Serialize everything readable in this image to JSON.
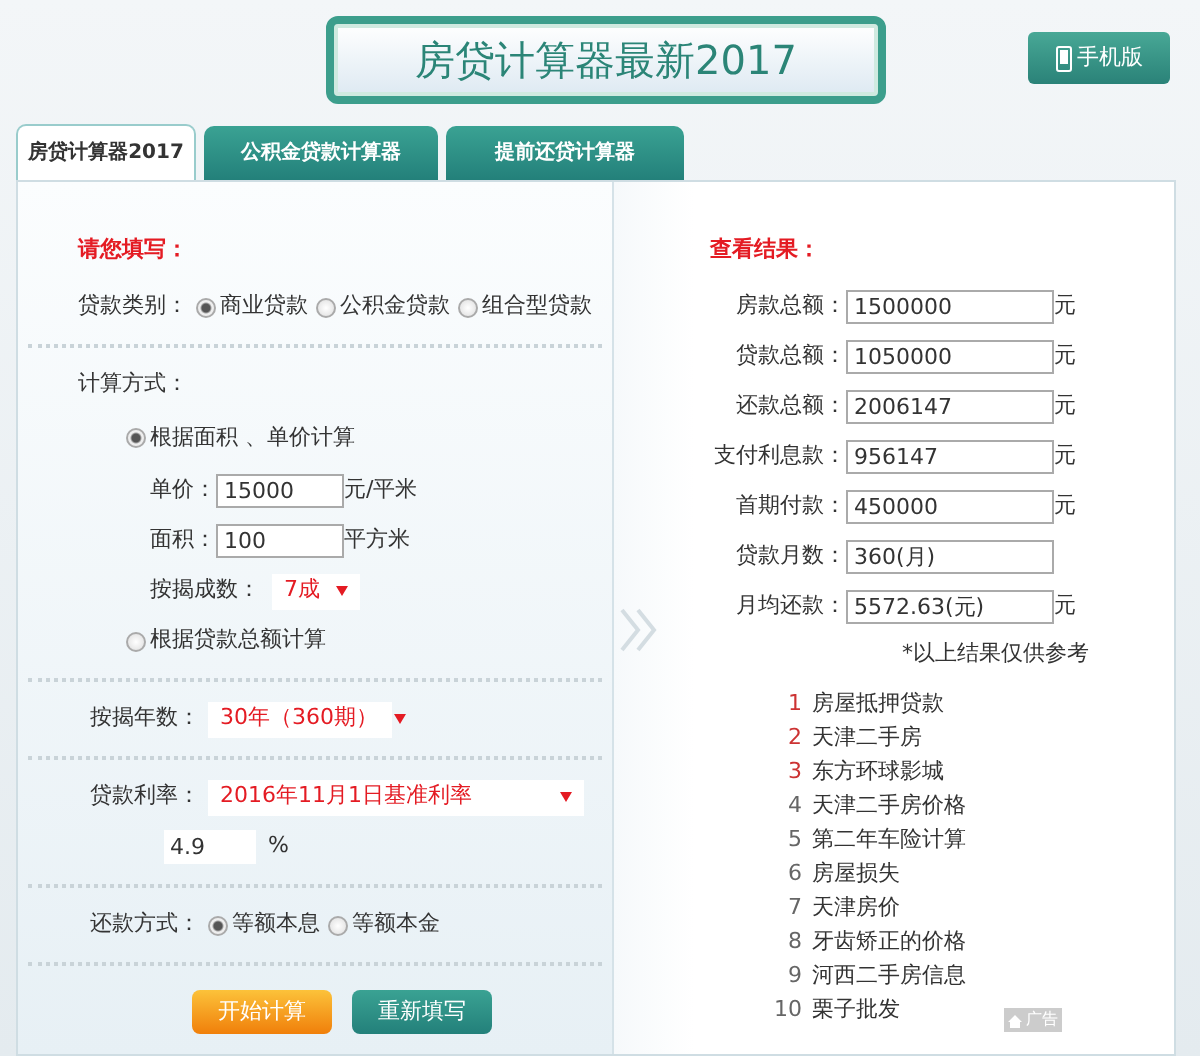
{
  "header": {
    "title": "房贷计算器最新2017",
    "mobile_button": "手机版"
  },
  "tabs": [
    {
      "label": "房贷计算器2017",
      "selected": true
    },
    {
      "label": "公积金贷款计算器",
      "selected": false
    },
    {
      "label": "提前还贷计算器",
      "selected": false
    }
  ],
  "form": {
    "heading": "请您填写：",
    "loan_type": {
      "label": "贷款类别：",
      "options": [
        {
          "label": "商业贷款",
          "selected": true
        },
        {
          "label": "公积金贷款",
          "selected": false
        },
        {
          "label": "组合型贷款",
          "selected": false
        }
      ]
    },
    "calc_method": {
      "label": "计算方式：",
      "options": [
        {
          "label": "根据面积 、单价计算",
          "selected": true
        },
        {
          "label": "根据贷款总额计算",
          "selected": false
        }
      ],
      "unit_price": {
        "label": "单价：",
        "value": "15000",
        "unit": "元/平米"
      },
      "area": {
        "label": "面积：",
        "value": "100",
        "unit": "平方米"
      },
      "down_ratio": {
        "label": "按揭成数：",
        "value": "7成"
      }
    },
    "years": {
      "label": "按揭年数：",
      "value": "30年（360期）"
    },
    "rate": {
      "label": "贷款利率：",
      "value": "2016年11月1日基准利率",
      "rate_value": "4.9",
      "unit": "%"
    },
    "repayment": {
      "label": "还款方式：",
      "options": [
        {
          "label": "等额本息",
          "selected": true
        },
        {
          "label": "等额本金",
          "selected": false
        }
      ]
    },
    "buttons": [
      {
        "label": "开始计算",
        "kind": "primary"
      },
      {
        "label": "重新填写",
        "kind": "secondary"
      }
    ]
  },
  "results": {
    "heading": "查看结果：",
    "rows": [
      {
        "label": "房款总额：",
        "value": "1500000",
        "unit": "元"
      },
      {
        "label": "贷款总额：",
        "value": "1050000",
        "unit": "元"
      },
      {
        "label": "还款总额：",
        "value": "2006147",
        "unit": "元"
      },
      {
        "label": "支付利息款：",
        "value": "956147",
        "unit": "元"
      },
      {
        "label": "首期付款：",
        "value": "450000",
        "unit": "元"
      },
      {
        "label": "贷款月数：",
        "value": "360(月)"
      },
      {
        "label": "月均还款：",
        "value": "5572.63(元)",
        "unit": "元"
      }
    ],
    "note": "*以上结果仅供参考"
  },
  "ad": {
    "items": [
      {
        "number": "1",
        "text": "房屋抵押贷款",
        "highlight": true
      },
      {
        "number": "2",
        "text": "天津二手房",
        "highlight": true
      },
      {
        "number": "3",
        "text": "东方环球影城",
        "highlight": true
      },
      {
        "number": "4",
        "text": "天津二手房价格",
        "highlight": false
      },
      {
        "number": "5",
        "text": "第二年车险计算",
        "highlight": false
      },
      {
        "number": "6",
        "text": "房屋损失",
        "highlight": false
      },
      {
        "number": "7",
        "text": "天津房价",
        "highlight": false
      },
      {
        "number": "8",
        "text": "牙齿矫正的价格",
        "highlight": false
      },
      {
        "number": "9",
        "text": "河西二手房信息",
        "highlight": false
      },
      {
        "number": "10",
        "text": "栗子批发",
        "highlight": false
      }
    ],
    "badge": "广告"
  }
}
